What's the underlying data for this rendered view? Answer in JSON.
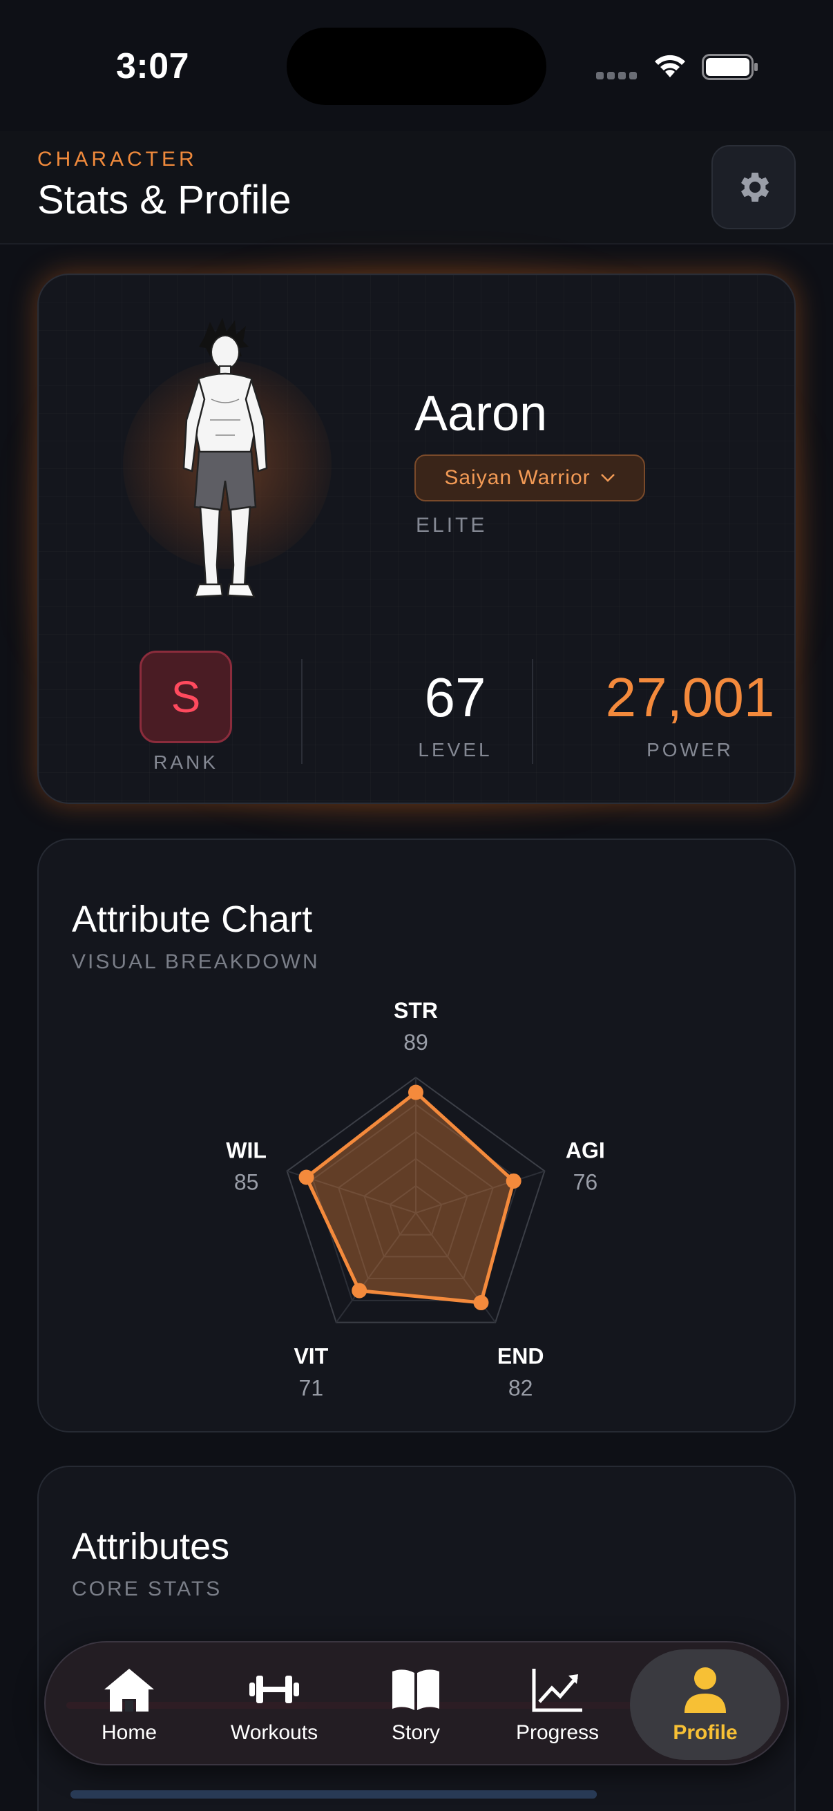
{
  "status_bar": {
    "time": "3:07"
  },
  "header": {
    "eyebrow": "CHARACTER",
    "title": "Stats & Profile"
  },
  "profile": {
    "name": "Aaron",
    "class": "Saiyan Warrior",
    "tier": "ELITE",
    "rank": {
      "value": "S",
      "label": "RANK"
    },
    "level": {
      "value": "67",
      "label": "LEVEL"
    },
    "power": {
      "value": "27,001",
      "label": "POWER"
    }
  },
  "attribute_chart": {
    "title": "Attribute Chart",
    "subtitle": "VISUAL BREAKDOWN",
    "chart_data": {
      "type": "radar",
      "axes": [
        "STR",
        "AGI",
        "END",
        "VIT",
        "WIL"
      ],
      "values": [
        89,
        76,
        82,
        71,
        85
      ],
      "value_labels": [
        "89",
        "76",
        "82",
        "71",
        "85"
      ],
      "max": 100,
      "rings": 5
    }
  },
  "attributes": {
    "title": "Attributes",
    "subtitle": "CORE STATS"
  },
  "tab_bar": {
    "items": [
      {
        "label": "Home",
        "icon": "home-icon"
      },
      {
        "label": "Workouts",
        "icon": "dumbbell-icon"
      },
      {
        "label": "Story",
        "icon": "book-icon"
      },
      {
        "label": "Progress",
        "icon": "chart-line-icon"
      },
      {
        "label": "Profile",
        "icon": "person-icon",
        "active": true
      }
    ]
  },
  "colors": {
    "accent": "#f48a3c",
    "rank": "#ff4a5e",
    "active_tab": "#f7c035"
  }
}
